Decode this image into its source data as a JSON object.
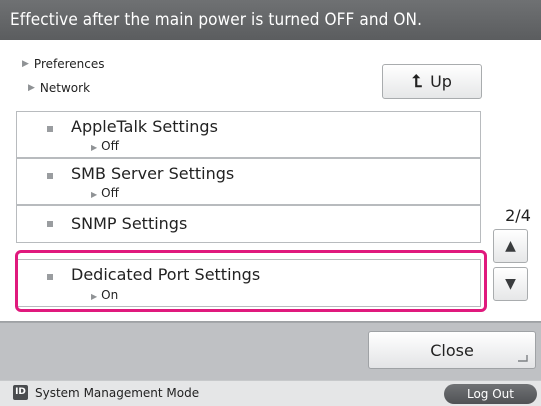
{
  "header": {
    "message": "Effective after the main power is turned OFF and ON."
  },
  "breadcrumb": {
    "level1": "Preferences",
    "level2": "Network",
    "arrow_icon": "right-triangle-icon"
  },
  "up_button": {
    "label": "Up",
    "icon": "up-arrow-icon"
  },
  "settings_list": {
    "items": [
      {
        "title": "AppleTalk Settings",
        "value": "Off"
      },
      {
        "title": "SMB Server Settings",
        "value": "Off"
      },
      {
        "title": "SNMP Settings",
        "value": ""
      },
      {
        "title": "Dedicated Port Settings",
        "value": "On",
        "selected": true
      }
    ]
  },
  "pager": {
    "current_page": "2/4"
  },
  "footer": {
    "close_label": "Close"
  },
  "status_bar": {
    "mode_icon_text": "ID",
    "mode_label": "System Management Mode",
    "logout_label": "Log Out"
  },
  "colors": {
    "header_bg": "#66686a",
    "selection": "#e0197d",
    "footer_bg": "#bfc1c4",
    "status_bg": "#e5e6e7"
  }
}
